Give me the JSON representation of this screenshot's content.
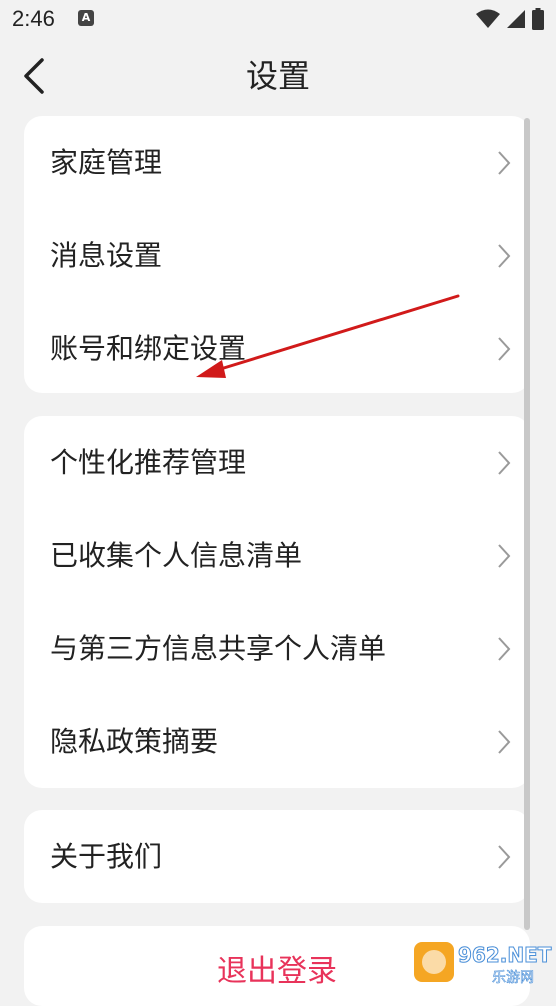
{
  "status_bar": {
    "time": "2:46"
  },
  "header": {
    "title": "设置"
  },
  "groups": [
    {
      "items": [
        {
          "label": "家庭管理"
        },
        {
          "label": "消息设置"
        },
        {
          "label": "账号和绑定设置"
        }
      ]
    },
    {
      "items": [
        {
          "label": "个性化推荐管理"
        },
        {
          "label": "已收集个人信息清单"
        },
        {
          "label": "与第三方信息共享个人清单"
        },
        {
          "label": "隐私政策摘要"
        }
      ]
    },
    {
      "items": [
        {
          "label": "关于我们"
        }
      ]
    }
  ],
  "logout": {
    "label": "退出登录",
    "color": "#e8335a"
  },
  "annotation": {
    "arrow_color": "#d11a1a"
  },
  "watermark": {
    "text": "962.NET",
    "subtext": "乐游网"
  }
}
